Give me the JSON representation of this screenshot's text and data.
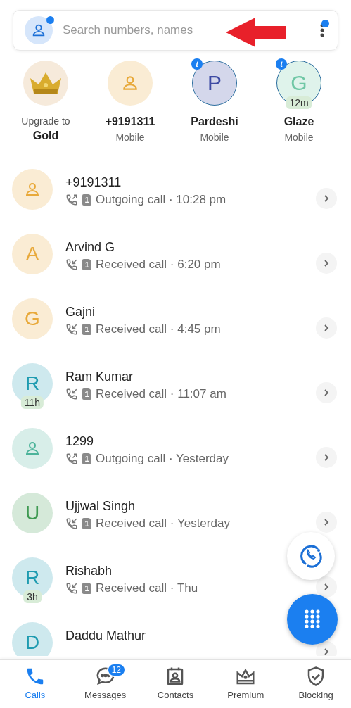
{
  "search": {
    "placeholder": "Search numbers, names",
    "profile_notification": true,
    "menu_notification": true
  },
  "favorites": [
    {
      "kind": "upgrade",
      "line1": "Upgrade to",
      "line2": "Gold"
    },
    {
      "kind": "person",
      "color": "#e8a93a",
      "name": "+9191311",
      "sub": "Mobile"
    },
    {
      "kind": "letter",
      "color": "#3d4aa3",
      "letter": "P",
      "badge": "t",
      "name": "Pardeshi",
      "sub": "Mobile"
    },
    {
      "kind": "letter",
      "color": "#6fc7a5",
      "letter": "G",
      "badge": "t",
      "time": "12m",
      "name": "Glaze",
      "sub": "Mobile"
    }
  ],
  "calls": [
    {
      "avatar": {
        "kind": "person",
        "color": "#e8a93a"
      },
      "name": "+9191311",
      "call_icon": {
        "kind": "outgoing"
      },
      "sim": "1",
      "detail": "Outgoing call · 10:28 pm"
    },
    {
      "avatar": {
        "kind": "letter",
        "letter": "A",
        "color": "#e8a93a"
      },
      "name": "Arvind G",
      "call_icon": {
        "kind": "received"
      },
      "sim": "1",
      "detail": "Received call · 6:20 pm"
    },
    {
      "avatar": {
        "kind": "letter",
        "letter": "G",
        "color": "#e8a93a"
      },
      "name": "Gajni",
      "call_icon": {
        "kind": "received"
      },
      "sim": "1",
      "detail": "Received call · 4:45 pm"
    },
    {
      "avatar": {
        "kind": "letter",
        "letter": "R",
        "color": "#1e9bb0",
        "time": "11h"
      },
      "name": "Ram Kumar",
      "call_icon": {
        "kind": "received"
      },
      "sim": "1",
      "detail": "Received call · 11:07 am"
    },
    {
      "avatar": {
        "kind": "person",
        "color": "#4cb39a"
      },
      "name": "1299",
      "call_icon": {
        "kind": "outgoing"
      },
      "sim": "1",
      "detail": "Outgoing call · Yesterday"
    },
    {
      "avatar": {
        "kind": "letter",
        "letter": "U",
        "color": "#3f9a52"
      },
      "name": "Ujjwal Singh",
      "call_icon": {
        "kind": "received"
      },
      "sim": "1",
      "detail": "Received call · Yesterday"
    },
    {
      "avatar": {
        "kind": "letter",
        "letter": "R",
        "color": "#1e9bb0",
        "time": "3h"
      },
      "name": "Rishabh",
      "call_icon": {
        "kind": "received"
      },
      "sim": "1",
      "detail": "Received call · Thu"
    },
    {
      "avatar": {
        "kind": "letter",
        "letter": "D",
        "color": "#1e9bb0"
      },
      "name": "Daddu Mathur"
    }
  ],
  "nav": [
    {
      "kind": "calls",
      "label": "Calls",
      "selected": true
    },
    {
      "kind": "messages",
      "label": "Messages",
      "selected": false,
      "badge": "12"
    },
    {
      "kind": "contacts",
      "label": "Contacts",
      "selected": false
    },
    {
      "kind": "premium",
      "label": "Premium",
      "selected": false
    },
    {
      "kind": "blocking",
      "label": "Blocking",
      "selected": false
    }
  ]
}
